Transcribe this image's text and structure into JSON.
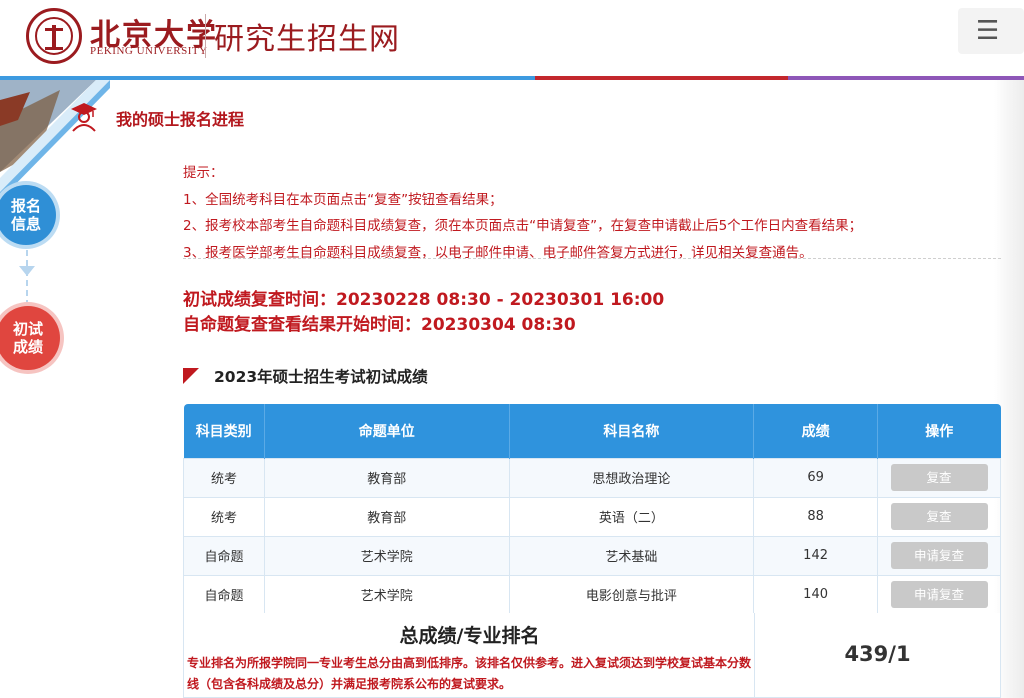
{
  "header": {
    "logo_cn": "北京大学",
    "logo_en": "PEKING UNIVERSITY",
    "site_title": "研究生招生网",
    "menu_icon": "hamburger-icon",
    "menu_glyph": "☰"
  },
  "colors": {
    "stripe": [
      "#3d9ae0",
      "#3d9ae0",
      "#c3272d",
      "#8e57b8"
    ],
    "brand_red": "#9b1b1f",
    "accent_blue": "#2f93dd",
    "text_red": "#c0191f"
  },
  "steps": [
    {
      "label": "报名信息"
    },
    {
      "label": "初试成绩"
    }
  ],
  "page": {
    "title": "我的硕士报名进程"
  },
  "tips": [
    "提示：",
    "1、全国统考科目在本页面点击“复查”按钮查看结果；",
    "2、报考校本部考生自命题科目成绩复查，须在本页面点击“申请复查”，在复查申请截止后5个工作日内查看结果；",
    "3、报考医学部考生自命题科目成绩复查，以电子邮件申请、电子邮件答复方式进行，详见相关复查通告。"
  ],
  "times": {
    "recheck": "初试成绩复查时间：20230228 08:30 - 20230301 16:00",
    "self_exam": "自命题复查查看结果开始时间：20230304 08:30"
  },
  "section": {
    "title": "2023年硕士招生考试初试成绩"
  },
  "table": {
    "headers": [
      "科目类别",
      "命题单位",
      "科目名称",
      "成绩",
      "操作"
    ],
    "rows": [
      {
        "category": "统考",
        "unit": "教育部",
        "subject": "思想政治理论",
        "score": "69",
        "action": "复查"
      },
      {
        "category": "统考",
        "unit": "教育部",
        "subject": "英语（二）",
        "score": "88",
        "action": "复查"
      },
      {
        "category": "自命题",
        "unit": "艺术学院",
        "subject": "艺术基础",
        "score": "142",
        "action": "申请复查"
      },
      {
        "category": "自命题",
        "unit": "艺术学院",
        "subject": "电影创意与批评",
        "score": "140",
        "action": "申请复查"
      }
    ]
  },
  "summary": {
    "title": "总成绩/专业排名",
    "note": "专业排名为所报学院同一专业考生总分由高到低排序。该排名仅供参考。进入复试须达到学校复试基本分数线（包含各科成绩及总分）并满足报考院系公布的复试要求。",
    "value": "439/1"
  }
}
